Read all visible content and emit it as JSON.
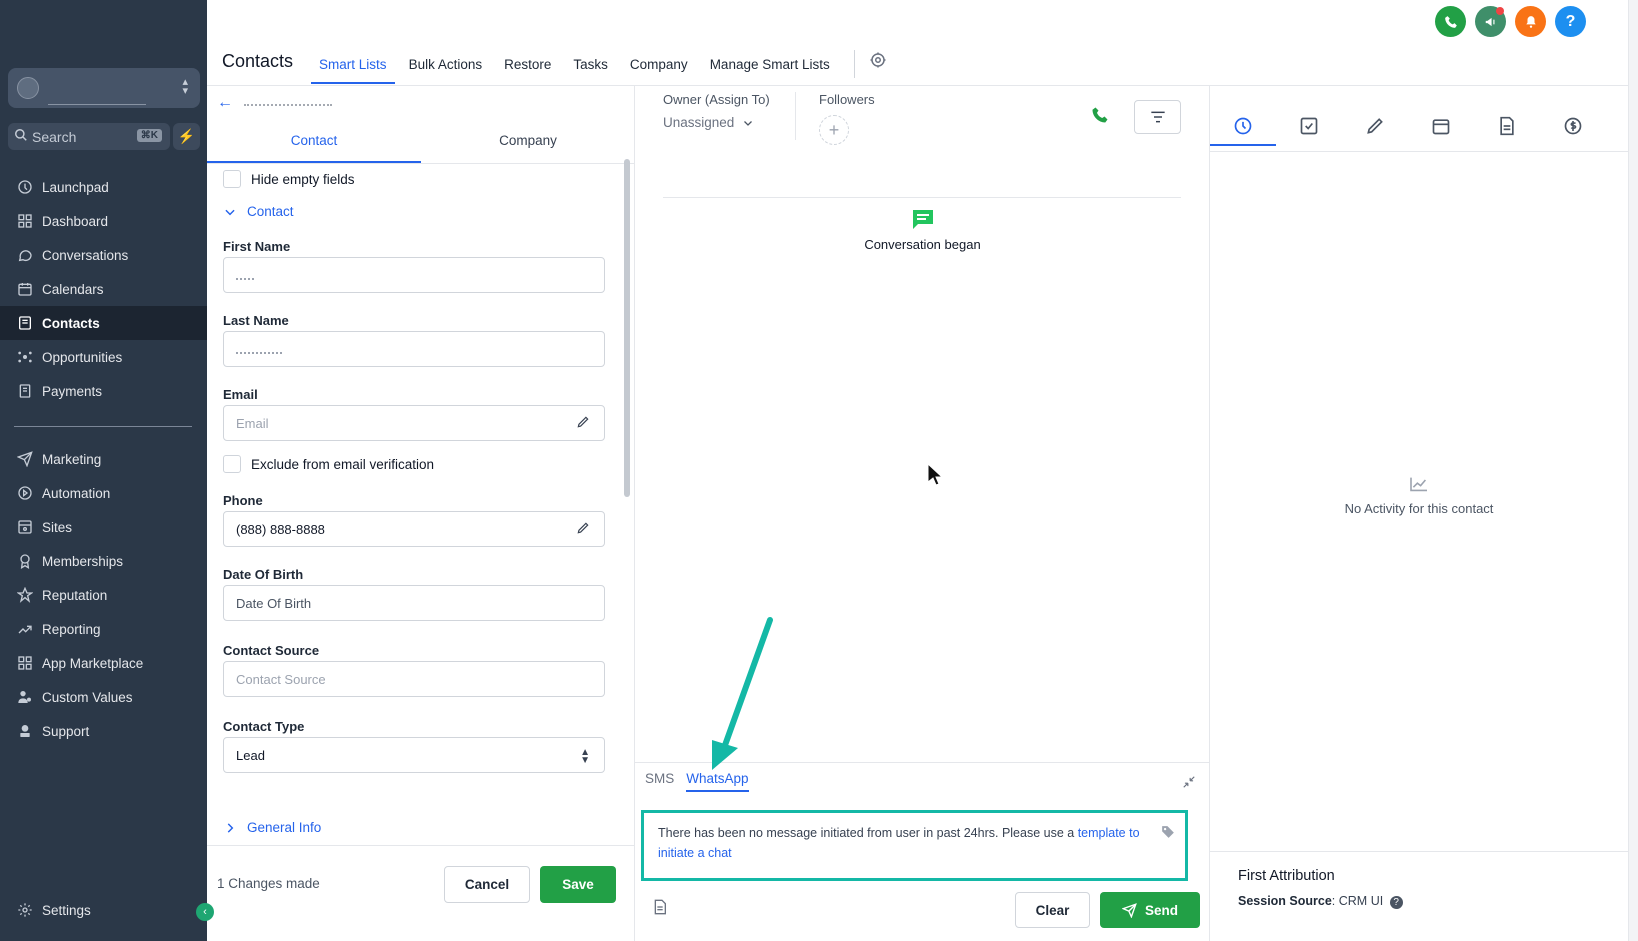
{
  "sidebar": {
    "search": {
      "placeholder": "Search",
      "shortcut": "⌘K"
    },
    "items": [
      {
        "label": "Launchpad",
        "icon": "launchpad-icon"
      },
      {
        "label": "Dashboard",
        "icon": "dashboard-icon"
      },
      {
        "label": "Conversations",
        "icon": "chat-icon"
      },
      {
        "label": "Calendars",
        "icon": "calendar-icon"
      },
      {
        "label": "Contacts",
        "icon": "contacts-icon",
        "active": true
      },
      {
        "label": "Opportunities",
        "icon": "opportunities-icon"
      },
      {
        "label": "Payments",
        "icon": "payments-icon"
      }
    ],
    "items2": [
      {
        "label": "Marketing",
        "icon": "send-icon"
      },
      {
        "label": "Automation",
        "icon": "automation-icon"
      },
      {
        "label": "Sites",
        "icon": "sites-icon"
      },
      {
        "label": "Memberships",
        "icon": "memberships-icon"
      },
      {
        "label": "Reputation",
        "icon": "star-icon"
      },
      {
        "label": "Reporting",
        "icon": "chart-line-icon"
      },
      {
        "label": "App Marketplace",
        "icon": "grid-icon"
      },
      {
        "label": "Custom Values",
        "icon": "user-gear-icon"
      },
      {
        "label": "Support",
        "icon": "support-icon"
      }
    ],
    "settings": "Settings"
  },
  "topbar": {
    "title": "Contacts",
    "tabs": [
      "Smart Lists",
      "Bulk Actions",
      "Restore",
      "Tasks",
      "Company",
      "Manage Smart Lists"
    ],
    "active_tab": "Smart Lists"
  },
  "contact_panel": {
    "tabs": [
      "Contact",
      "Company"
    ],
    "hide_empty": "Hide empty fields",
    "section": "Contact",
    "fields": {
      "first_name": {
        "label": "First Name"
      },
      "last_name": {
        "label": "Last Name"
      },
      "email": {
        "label": "Email",
        "placeholder": "Email"
      },
      "exclude_email": "Exclude from email verification",
      "phone": {
        "label": "Phone",
        "value": "(888) 888-8888"
      },
      "dob": {
        "label": "Date Of Birth",
        "placeholder": "Date Of Birth"
      },
      "source": {
        "label": "Contact Source",
        "placeholder": "Contact Source"
      },
      "type": {
        "label": "Contact Type",
        "value": "Lead"
      }
    },
    "general_info": "General Info",
    "changes": "1 Changes made",
    "cancel": "Cancel",
    "save": "Save"
  },
  "conversation": {
    "owner_label": "Owner (Assign To)",
    "owner_value": "Unassigned",
    "followers_label": "Followers",
    "began": "Conversation began",
    "channels": [
      "SMS",
      "WhatsApp"
    ],
    "active_channel": "WhatsApp",
    "notice_text": "There has been no message initiated from user in past 24hrs. Please use a ",
    "notice_link": "template to initiate a chat",
    "clear": "Clear",
    "send": "Send"
  },
  "activity": {
    "empty": "No Activity for this contact",
    "attribution_title": "First Attribution",
    "session_source_label": "Session Source",
    "session_source_value": "CRM UI"
  },
  "colors": {
    "accent": "#2563eb",
    "save_green": "#22a046",
    "sidebar": "#2b3848",
    "highlight": "#14b8a6"
  }
}
